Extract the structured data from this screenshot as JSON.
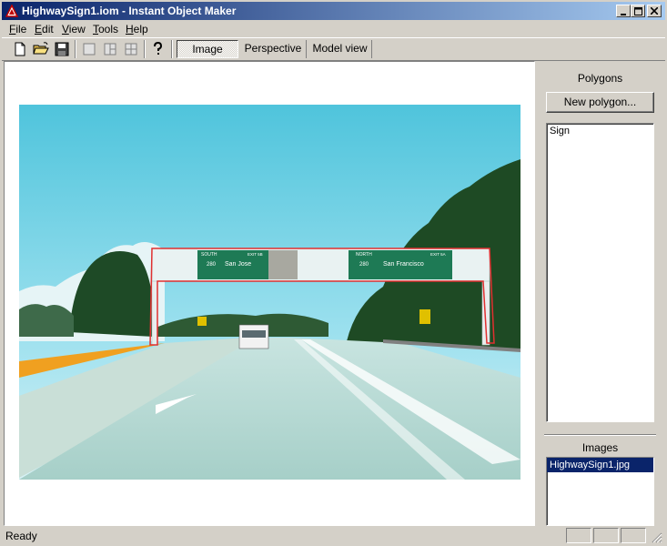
{
  "window": {
    "title": "HighwaySign1.iom - Instant Object Maker"
  },
  "menu": [
    {
      "label": "File",
      "key": "F"
    },
    {
      "label": "Edit",
      "key": "E"
    },
    {
      "label": "View",
      "key": "V"
    },
    {
      "label": "Tools",
      "key": "T"
    },
    {
      "label": "Help",
      "key": "H"
    }
  ],
  "toolbar": {
    "icons": [
      "new-document-icon",
      "open-folder-icon",
      "save-disk-icon",
      "single-view-icon",
      "split-view-icon",
      "quad-view-icon",
      "help-question-icon"
    ],
    "tabs": [
      "Image",
      "Perspective",
      "Model view"
    ],
    "active_tab": "Image"
  },
  "polygons": {
    "title": "Polygons",
    "new_button": "New polygon...",
    "items": [
      "Sign"
    ]
  },
  "images": {
    "title": "Images",
    "items": [
      "HighwaySign1.jpg"
    ],
    "selected": "HighwaySign1.jpg"
  },
  "signs": {
    "left": {
      "direction": "SOUTH",
      "exit": "EXIT 5B",
      "route": "280",
      "city": "San Jose"
    },
    "right": {
      "direction": "NORTH",
      "exit": "EXIT 5A",
      "route": "280",
      "city": "San Francisco"
    }
  },
  "status": {
    "text": "Ready"
  },
  "colors": {
    "title_start": "#0a246a",
    "title_end": "#a6caf0",
    "selection": "#0a246a",
    "sign_green": "#1e7a55",
    "polygon_outline": "#e03030"
  }
}
